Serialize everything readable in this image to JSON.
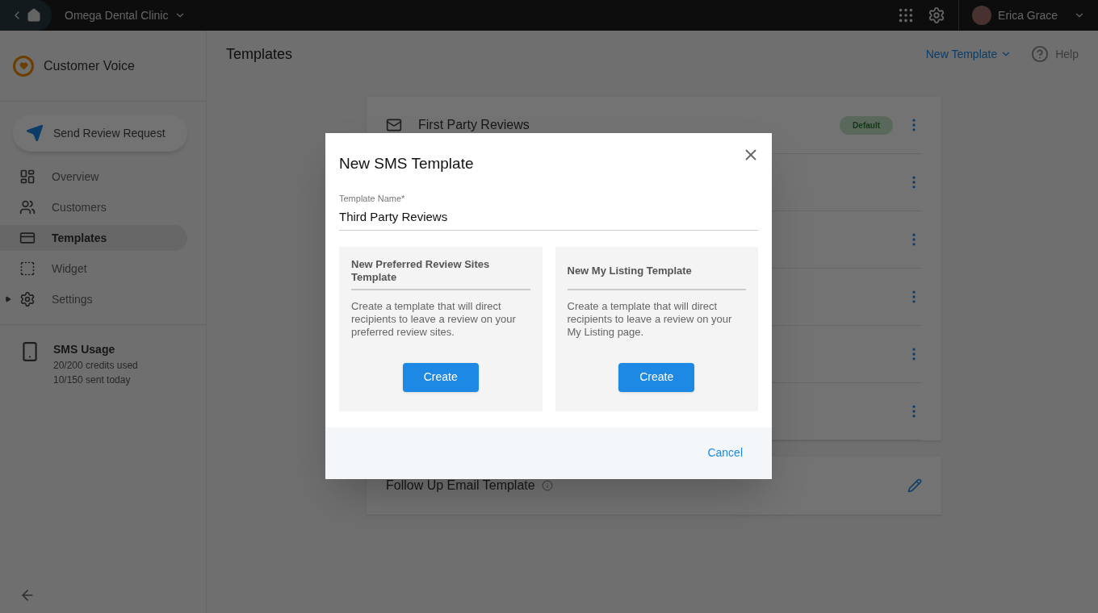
{
  "topbar": {
    "business": "Omega Dental Clinic",
    "user": "Erica Grace"
  },
  "sidebar": {
    "product": "Customer Voice",
    "action": "Send Review Request",
    "items": [
      {
        "label": "Overview",
        "selected": false,
        "expandable": false
      },
      {
        "label": "Customers",
        "selected": false,
        "expandable": false
      },
      {
        "label": "Templates",
        "selected": true,
        "expandable": false
      },
      {
        "label": "Widget",
        "selected": false,
        "expandable": false
      },
      {
        "label": "Settings",
        "selected": false,
        "expandable": true
      }
    ],
    "usage": {
      "title": "SMS Usage",
      "lines": [
        "20/200 credits used",
        "10/150 sent today"
      ]
    }
  },
  "header": {
    "title": "Templates",
    "new_button": "New Template",
    "help": "Help"
  },
  "template_rows": [
    {
      "kind": "template",
      "title": "First Party Reviews",
      "badge": "Default"
    },
    {
      "kind": "covered"
    },
    {
      "kind": "covered"
    },
    {
      "kind": "covered"
    },
    {
      "kind": "covered"
    },
    {
      "kind": "covered"
    }
  ],
  "follow_up": {
    "title": "Follow Up Email Template"
  },
  "dialog": {
    "title": "New SMS Template",
    "field": {
      "label": "Template Name*",
      "value": "Third Party Reviews"
    },
    "options": [
      {
        "title": "New Preferred Review Sites Template",
        "description": "Create a template that will direct recipients to leave a review on your preferred review sites.",
        "button": "Create"
      },
      {
        "title": "New My Listing Template",
        "description": "Create a template that will direct recipients to leave a review on your My Listing page.",
        "button": "Create"
      }
    ],
    "cancel": "Cancel"
  }
}
